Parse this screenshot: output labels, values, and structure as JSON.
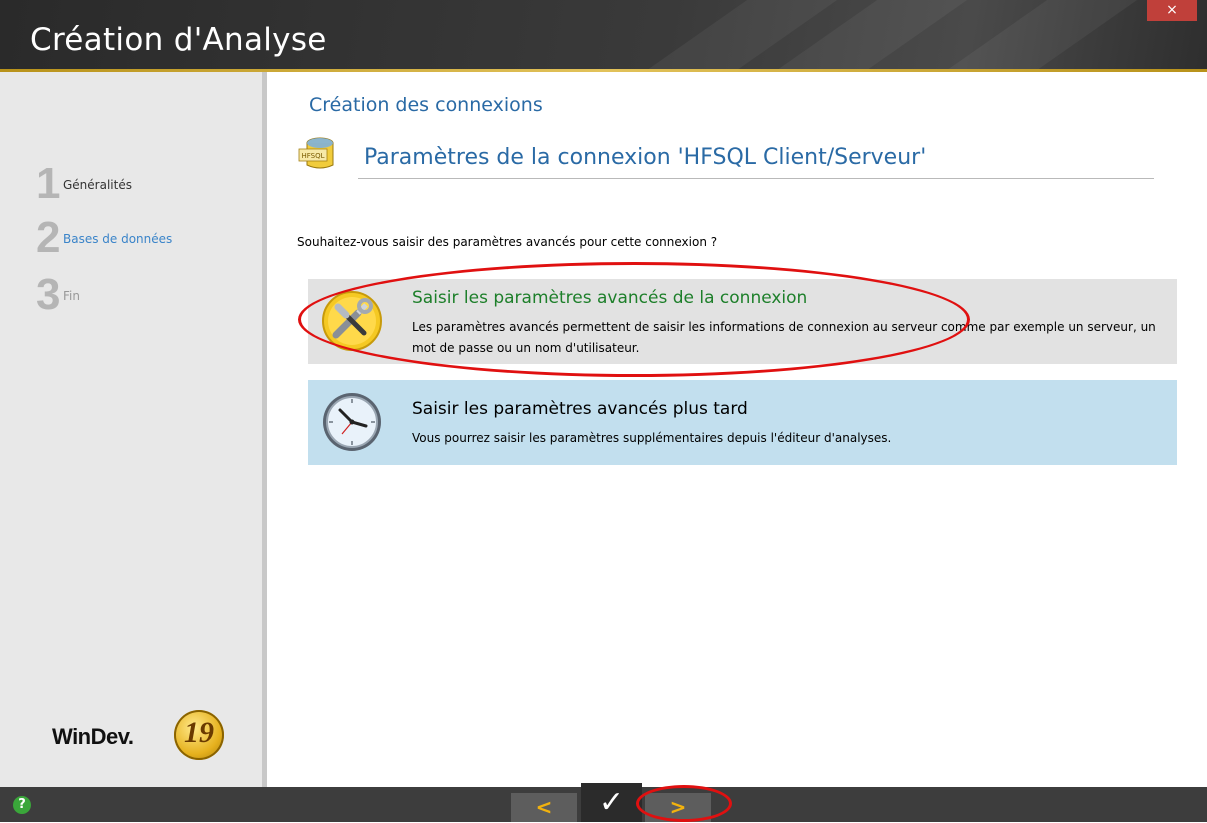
{
  "window": {
    "title": "Création d'Analyse",
    "close_label": "×"
  },
  "steps": [
    {
      "number": "1",
      "label": "Généralités"
    },
    {
      "number": "2",
      "label": "Bases de données"
    },
    {
      "number": "3",
      "label": "Fin"
    }
  ],
  "brand": {
    "name": "WinDev.",
    "version": "19"
  },
  "main": {
    "section_title": "Création des connexions",
    "subtitle": "Paramètres de la connexion 'HFSQL Client/Serveur'",
    "icon_label": "HFSQL",
    "question": "Souhaitez-vous saisir des paramètres avancés pour cette connexion ?",
    "options": [
      {
        "title": "Saisir les paramètres avancés de la connexion",
        "description": "Les paramètres avancés permettent de saisir les informations de connexion au serveur comme par exemple un serveur, un mot de passe ou un nom d'utilisateur.",
        "icon": "tools-icon"
      },
      {
        "title": "Saisir les paramètres avancés plus tard",
        "description": "Vous pourrez saisir les paramètres supplémentaires depuis l'éditeur d'analyses.",
        "icon": "clock-icon"
      }
    ]
  },
  "bottom": {
    "help_label": "?",
    "prev_label": "<",
    "finish_label": "✓",
    "next_label": ">"
  },
  "colors": {
    "annotation": "#e01010",
    "accent": "#2a6aa5",
    "option1_bg": "#e2e2e2",
    "option2_bg": "#c2dfee"
  }
}
